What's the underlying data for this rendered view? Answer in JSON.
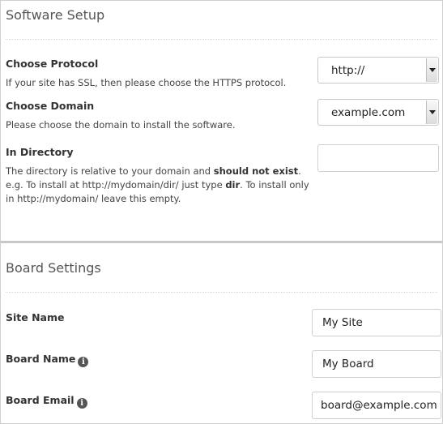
{
  "software_setup": {
    "title": "Software Setup",
    "protocol": {
      "label": "Choose Protocol",
      "description": "If your site has SSL, then please choose the HTTPS protocol.",
      "selected": "http://"
    },
    "domain": {
      "label": "Choose Domain",
      "description": "Please choose the domain to install the software.",
      "selected": "example.com"
    },
    "directory": {
      "label": "In Directory",
      "desc_1": "The directory is relative to your domain and ",
      "desc_2": "should not exist",
      "desc_3": ". e.g. To install at http://mydomain/dir/ just type ",
      "desc_4": "dir",
      "desc_5": ". To install only in http://mydomain/ leave this empty.",
      "value": ""
    }
  },
  "board_settings": {
    "title": "Board Settings",
    "site_name": {
      "label": "Site Name",
      "value": "My Site"
    },
    "board_name": {
      "label": "Board Name",
      "value": "My Board"
    },
    "board_email": {
      "label": "Board Email",
      "value": "board@example.com"
    }
  }
}
